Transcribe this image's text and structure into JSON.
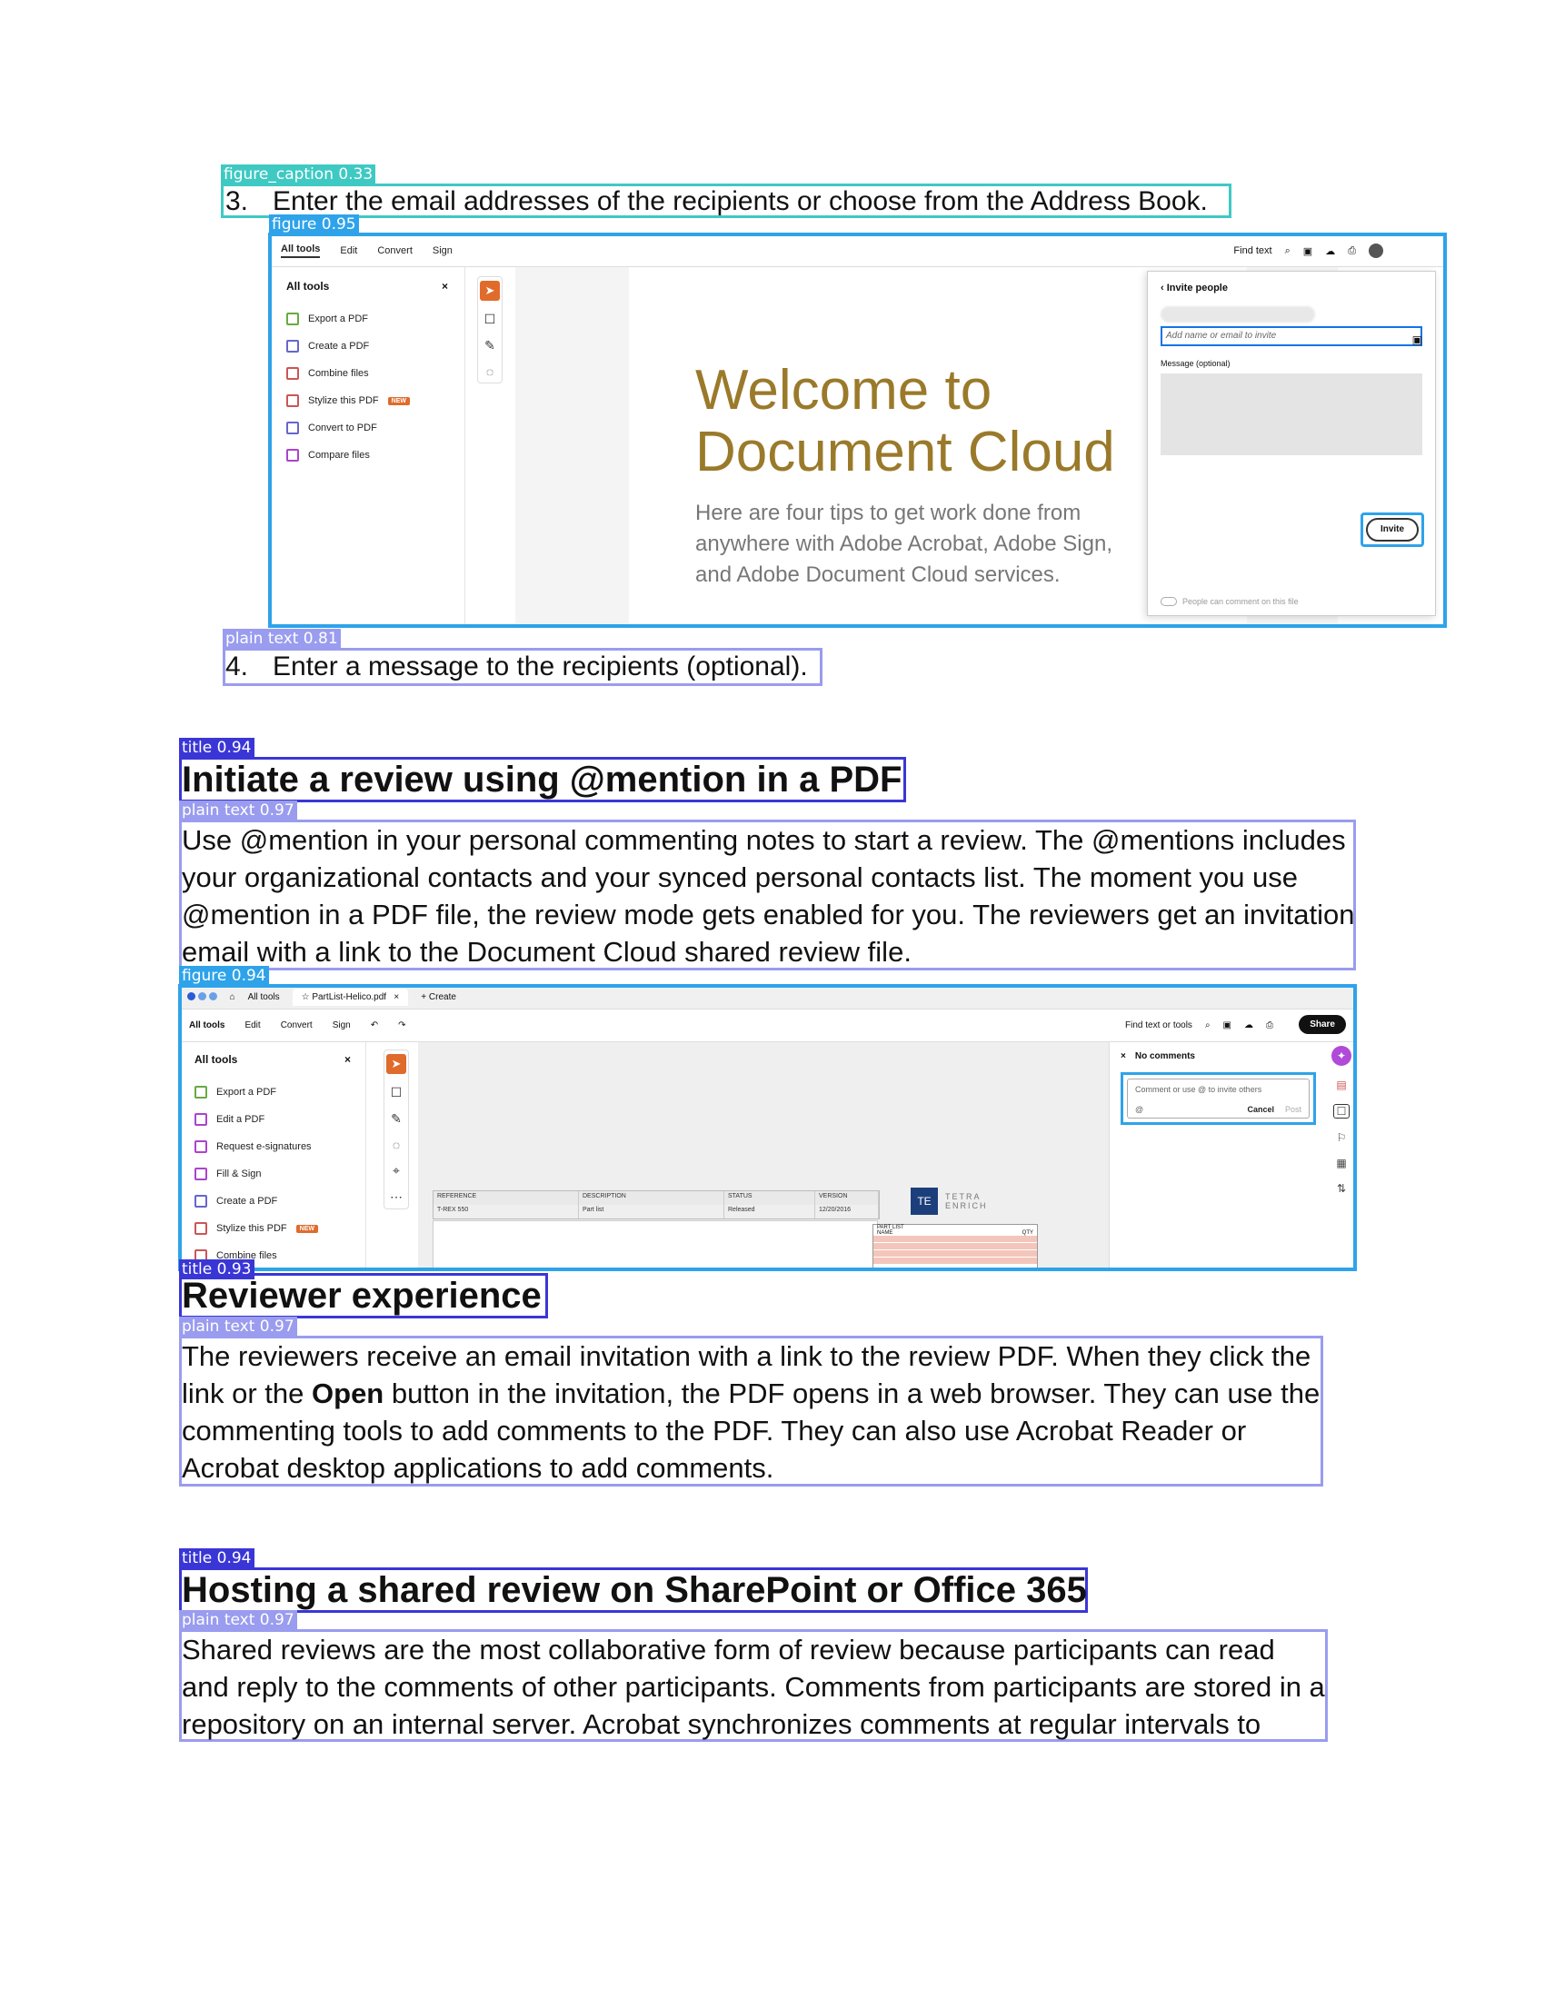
{
  "labels": {
    "caption": "figure_caption 0.33",
    "figure1": "figure 0.95",
    "plain1": "plain text 0.81",
    "title1": "title 0.94",
    "plain2": "plain text 0.97",
    "figure2": "figure 0.94",
    "title2": "title 0.93",
    "plain3": "plain text 0.97",
    "title3": "title 0.94",
    "plain4": "plain text 0.97"
  },
  "document": {
    "step3_num": "3.",
    "step3_text": "Enter the email addresses of the recipients or choose from the Address Book.",
    "step4_num": "4.",
    "step4_text": "Enter a message to the recipients (optional).",
    "heading1": "Initiate a review using @mention in a PDF",
    "para1": "Use @mention in your personal commenting notes to start a review. The @mentions includes your organizational contacts and your synced personal contacts list. The moment you use @mention in a PDF file, the review mode gets enabled for you. The reviewers get an invitation email with a link to the Document Cloud shared review file.",
    "heading2": "Reviewer experience",
    "para2_a": "The reviewers receive an email invitation with a link to the review PDF. When they click the link or the ",
    "para2_bold": "Open",
    "para2_b": " button in the invitation, the PDF opens in a web browser. They can use the commenting tools to add comments to the PDF. They can also use Acrobat Reader or Acrobat desktop applications to add comments.",
    "heading3": "Hosting a shared review on SharePoint or Office 365",
    "para3": "Shared reviews are the most collaborative form of review because participants can read and reply to the comments of other participants. Comments from participants are stored in a repository on an internal server. Acrobat synchronizes comments at regular intervals to"
  },
  "shot1": {
    "menu": [
      "All tools",
      "Edit",
      "Convert",
      "Sign"
    ],
    "find": "Find text",
    "panel_title": "All tools",
    "tools": [
      "Export a PDF",
      "Create a PDF",
      "Combine files",
      "Stylize this PDF",
      "Convert to PDF",
      "Compare files"
    ],
    "new_badge": "NEW",
    "welcome": "Welcome to Document Cloud",
    "welcome_sub": "Here are four tips to get work done from anywhere with Adobe Acrobat, Adobe Sign, and Adobe Document Cloud services.",
    "invite_title": "Invite people",
    "invite_placeholder": "Add name or email to invite",
    "message_label": "Message (optional)",
    "invite_button": "Invite",
    "toggle_label": "People can comment on this file"
  },
  "shot2": {
    "home": "All tools",
    "tab": "PartList-Helico.pdf",
    "create": "Create",
    "menu": [
      "All tools",
      "Edit",
      "Convert",
      "Sign"
    ],
    "find": "Find text or tools",
    "share": "Share",
    "panel_title": "All tools",
    "tools": [
      "Export a PDF",
      "Edit a PDF",
      "Request e-signatures",
      "Fill & Sign",
      "Create a PDF",
      "Stylize this PDF",
      "Combine files"
    ],
    "new_badge": "NEW",
    "comments_title": "No comments",
    "comment_placeholder": "Comment or use @ to invite others",
    "cancel": "Cancel",
    "post": "Post",
    "table_headers": [
      "REFERENCE",
      "DESCRIPTION",
      "STATUS",
      "VERSION"
    ],
    "table_row": [
      "T-REX 550",
      "Part list",
      "Released",
      "12/20/2016"
    ],
    "logo_text": "TE",
    "brand": "TETRA",
    "brand_sub": "ENRICH",
    "parts_title": "PART LIST",
    "parts_cols": [
      "NAME",
      "QTY"
    ]
  }
}
